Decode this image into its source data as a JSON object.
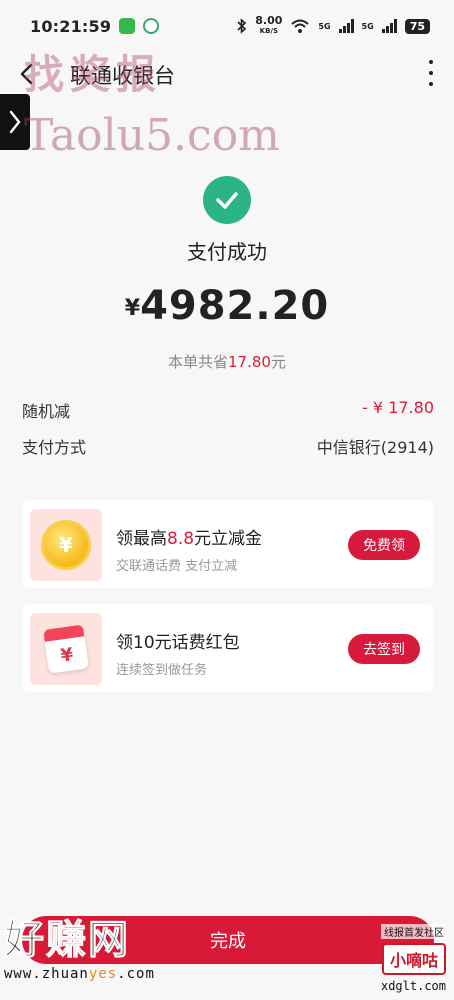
{
  "status_bar": {
    "time": "10:21:59",
    "net_speed": "8.00",
    "net_unit": "KB/S",
    "sig1": "5G",
    "sig2": "5G",
    "battery": "75"
  },
  "nav": {
    "title": "联通收银台"
  },
  "watermark": {
    "top_text": "找奖报",
    "site_text": "Taolu5.com",
    "bottom_big": "好赚网",
    "bottom_url_a": "www.zhuan",
    "bottom_url_b": "yes",
    "bottom_url_c": ".com",
    "right_line1": "线报首发社区",
    "right_line2": "小嘀咕",
    "right_line3": "xdglt.com"
  },
  "result": {
    "status": "支付成功",
    "currency": "¥",
    "amount": "4982.20",
    "save_prefix": "本单共省",
    "save_amount": "17.80",
    "save_suffix": "元"
  },
  "details": [
    {
      "label": "随机减",
      "value": "- ¥ 17.80"
    },
    {
      "label": "支付方式",
      "value": "中信银行(2914)"
    }
  ],
  "promos": [
    {
      "title_prefix": "领最高",
      "title_highlight": "8.8",
      "title_suffix": "元立减金",
      "subtitle": "交联通话费 支付立减",
      "button": "免费领",
      "icon_glyph": "¥"
    },
    {
      "title_prefix": "领10元话费红包",
      "title_highlight": "",
      "title_suffix": "",
      "subtitle": "连续签到做任务",
      "button": "去签到",
      "icon_glyph": "¥"
    }
  ],
  "done_button": "完成",
  "colors": {
    "accent_red": "#d91a36",
    "success_green": "#2bb488",
    "background": "#f7f7f7"
  }
}
